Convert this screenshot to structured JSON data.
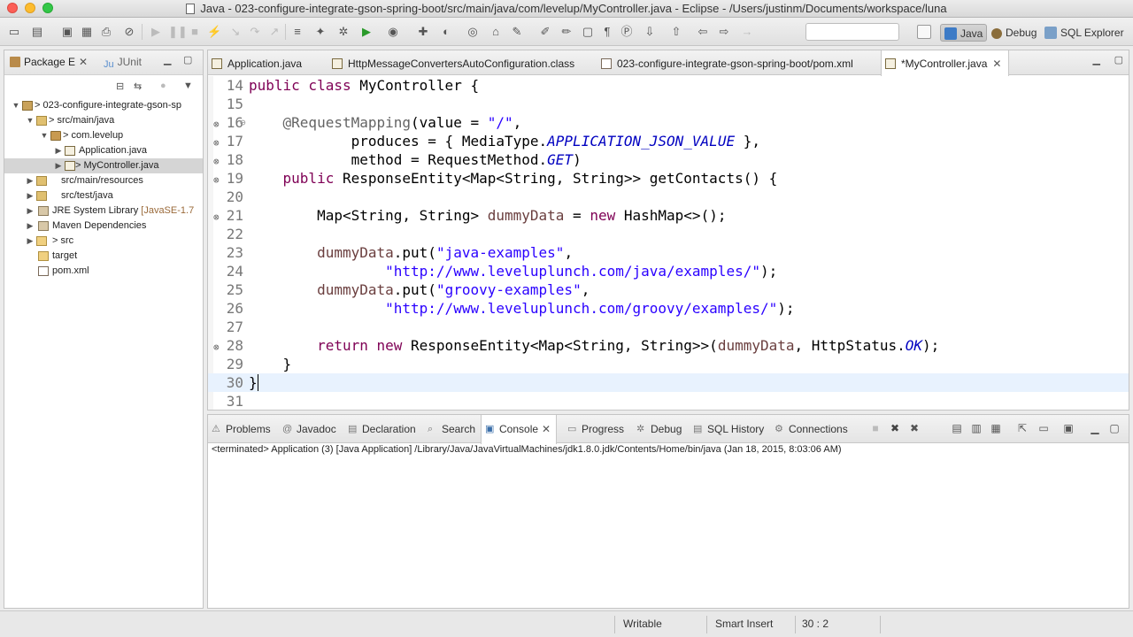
{
  "window": {
    "title": "Java - 023-configure-integrate-gson-spring-boot/src/main/java/com/levelup/MyController.java - Eclipse - /Users/justinm/Documents/workspace/luna"
  },
  "toolbar": {
    "quick_access_value": "",
    "perspectives": [
      {
        "label": "Java",
        "icon": "java-perspective-icon",
        "active": true
      },
      {
        "label": "Debug",
        "icon": "bug-icon",
        "active": false
      },
      {
        "label": "SQL Explorer",
        "icon": "database-icon",
        "active": false
      }
    ]
  },
  "package_explorer": {
    "tabs": [
      {
        "label": "Package E",
        "active": true
      },
      {
        "label": "JUnit",
        "active": false
      }
    ],
    "tree": [
      {
        "label": "> 023-configure-integrate-gson-sp",
        "icon": "project-icon",
        "depth": 0,
        "expanded": true
      },
      {
        "label": "> src/main/java",
        "icon": "source-folder-icon",
        "depth": 1,
        "expanded": true
      },
      {
        "label": "> com.levelup",
        "icon": "package-icon",
        "depth": 2,
        "expanded": true
      },
      {
        "label": "Application.java",
        "icon": "java-file-icon",
        "depth": 3,
        "expanded": false
      },
      {
        "label": "> MyController.java",
        "icon": "java-file-icon",
        "depth": 3,
        "expanded": false,
        "selected": true
      },
      {
        "label": "src/main/resources",
        "icon": "source-folder-icon",
        "depth": 1,
        "expanded": false
      },
      {
        "label": "src/test/java",
        "icon": "source-folder-icon",
        "depth": 1,
        "expanded": false
      },
      {
        "label": "JRE System Library",
        "extra": "[JavaSE-1.7",
        "icon": "library-icon",
        "depth": 1,
        "expanded": false
      },
      {
        "label": "Maven Dependencies",
        "icon": "library-icon",
        "depth": 1,
        "expanded": false
      },
      {
        "label": "> src",
        "icon": "folder-icon",
        "depth": 1,
        "expanded": false
      },
      {
        "label": "target",
        "icon": "folder-icon",
        "depth": 1,
        "leaf": true
      },
      {
        "label": "pom.xml",
        "icon": "xml-file-icon",
        "depth": 1,
        "leaf": true
      }
    ]
  },
  "editor": {
    "tabs": [
      {
        "label": "Application.java",
        "icon": "java-file-icon",
        "active": false
      },
      {
        "label": "HttpMessageConvertersAutoConfiguration.class",
        "icon": "class-file-icon",
        "active": false
      },
      {
        "label": "023-configure-integrate-gson-spring-boot/pom.xml",
        "icon": "xml-file-icon",
        "active": false
      },
      {
        "label": "*MyController.java",
        "icon": "java-file-icon",
        "active": true
      }
    ],
    "lines": [
      {
        "n": "14",
        "text": "public class MyController {"
      },
      {
        "n": "15",
        "text": ""
      },
      {
        "n": "16",
        "text": "    @RequestMapping(value = \"/\",",
        "marker": true,
        "fold": true
      },
      {
        "n": "17",
        "text": "            produces = { MediaType.APPLICATION_JSON_VALUE },",
        "marker": true
      },
      {
        "n": "18",
        "text": "            method = RequestMethod.GET)",
        "marker": true
      },
      {
        "n": "19",
        "text": "    public ResponseEntity<Map<String, String>> getContacts() {",
        "marker": true
      },
      {
        "n": "20",
        "text": ""
      },
      {
        "n": "21",
        "text": "        Map<String, String> dummyData = new HashMap<>();",
        "marker": true
      },
      {
        "n": "22",
        "text": ""
      },
      {
        "n": "23",
        "text": "        dummyData.put(\"java-examples\","
      },
      {
        "n": "24",
        "text": "                \"http://www.leveluplunch.com/java/examples/\");"
      },
      {
        "n": "25",
        "text": "        dummyData.put(\"groovy-examples\","
      },
      {
        "n": "26",
        "text": "                \"http://www.leveluplunch.com/groovy/examples/\");"
      },
      {
        "n": "27",
        "text": ""
      },
      {
        "n": "28",
        "text": "        return new ResponseEntity<Map<String, String>>(dummyData, HttpStatus.OK);",
        "marker": true
      },
      {
        "n": "29",
        "text": "    }"
      },
      {
        "n": "30",
        "text": "}",
        "current": true
      },
      {
        "n": "31",
        "text": ""
      }
    ]
  },
  "console": {
    "tabs": [
      {
        "label": "Problems",
        "icon": "problems-icon",
        "active": false
      },
      {
        "label": "Javadoc",
        "icon": "javadoc-icon",
        "active": false
      },
      {
        "label": "Declaration",
        "icon": "declaration-icon",
        "active": false
      },
      {
        "label": "Search",
        "icon": "search-icon",
        "active": false
      },
      {
        "label": "Console",
        "icon": "console-icon",
        "active": true
      },
      {
        "label": "Progress",
        "icon": "progress-icon",
        "active": false
      },
      {
        "label": "Debug",
        "icon": "bug-icon",
        "active": false
      },
      {
        "label": "SQL History",
        "icon": "sql-history-icon",
        "active": false
      },
      {
        "label": "Connections",
        "icon": "connections-icon",
        "active": false
      }
    ],
    "header": "<terminated> Application (3) [Java Application] /Library/Java/JavaVirtualMachines/jdk1.8.0.jdk/Contents/Home/bin/java (Jan 18, 2015, 8:03:06 AM)"
  },
  "statusbar": {
    "writable": "Writable",
    "insert_mode": "Smart Insert",
    "position": "30 : 2"
  }
}
